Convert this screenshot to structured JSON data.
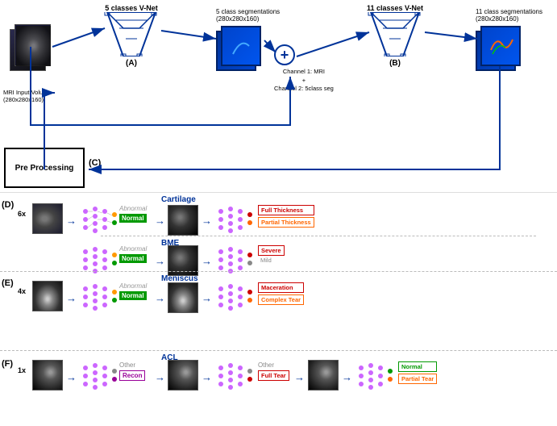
{
  "top": {
    "mri_label": "MRI Input Volume\n(280x280x160)",
    "vnet_a_label": "5 classes V-Net",
    "label_a": "(A)",
    "seg_a_label": "5 class segmentations\n(280x280x160)",
    "plus_label": "+",
    "channel1": "Channel 1: MRI",
    "plus_sym": "+",
    "channel2": "Channel 2: 5class seg",
    "vnet_b_label": "11 classes V-Net",
    "label_b": "(B)",
    "seg_b_label": "11 class segmentations\n(280x280x160)",
    "preproc_label": "Pre Processing",
    "label_c": "(C)"
  },
  "rows": {
    "d_label": "(D)",
    "d_mult": "6x",
    "d_title": "Cartilage",
    "d_normal": "Normal",
    "d_abnormal": "Abnormal",
    "d_result1": "Full Thickness",
    "d_result2": "Partial Thickness",
    "e_label": "(E)",
    "e_mult": "4x",
    "e_title": "Meniscus",
    "e_normal": "Normal",
    "e_abnormal": "Abnormal",
    "e_result1": "Maceration",
    "e_result2": "Complex Tear",
    "bme_title": "BME",
    "bme_normal": "Normal",
    "bme_abnormal": "Abnormal",
    "bme_result1": "Severe",
    "bme_result2": "Mild",
    "f_label": "(F)",
    "f_mult": "1x",
    "f_title": "ACL",
    "f_other1": "Other",
    "f_recon": "Recon",
    "f_other2": "Other",
    "f_full_tear": "Full Tear",
    "f_normal": "Normal",
    "f_partial_tear": "Partial Tear"
  }
}
